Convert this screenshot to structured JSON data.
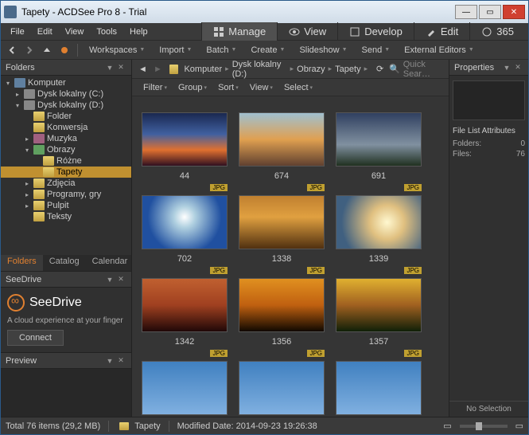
{
  "window": {
    "title": "Tapety - ACDSee Pro 8 - Trial"
  },
  "menu": [
    "File",
    "Edit",
    "View",
    "Tools",
    "Help"
  ],
  "modes": [
    {
      "label": "Manage",
      "active": true,
      "icon": "grid"
    },
    {
      "label": "View",
      "active": false,
      "icon": "eye"
    },
    {
      "label": "Develop",
      "active": false,
      "icon": "dev"
    },
    {
      "label": "Edit",
      "active": false,
      "icon": "wrench"
    },
    {
      "label": "365",
      "active": false,
      "icon": "365"
    }
  ],
  "toolbar_menus": [
    "Workspaces",
    "Import",
    "Batch",
    "Create",
    "Slideshow",
    "Send",
    "External Editors"
  ],
  "folders": {
    "title": "Folders",
    "tree": [
      {
        "label": "Komputer",
        "depth": 0,
        "exp": "▾",
        "icon": "comp"
      },
      {
        "label": "Dysk lokalny (C:)",
        "depth": 1,
        "exp": "▸",
        "icon": "drive"
      },
      {
        "label": "Dysk lokalny (D:)",
        "depth": 1,
        "exp": "▾",
        "icon": "drive"
      },
      {
        "label": "Folder",
        "depth": 2,
        "exp": "",
        "icon": "fold"
      },
      {
        "label": "Konwersja",
        "depth": 2,
        "exp": "",
        "icon": "fold"
      },
      {
        "label": "Muzyka",
        "depth": 2,
        "exp": "▸",
        "icon": "mus"
      },
      {
        "label": "Obrazy",
        "depth": 2,
        "exp": "▾",
        "icon": "img"
      },
      {
        "label": "Różne",
        "depth": 3,
        "exp": "",
        "icon": "fold"
      },
      {
        "label": "Tapety",
        "depth": 3,
        "exp": "",
        "icon": "fold",
        "sel": true
      },
      {
        "label": "Zdjęcia",
        "depth": 2,
        "exp": "▸",
        "icon": "fold"
      },
      {
        "label": "Programy, gry",
        "depth": 2,
        "exp": "▸",
        "icon": "fold"
      },
      {
        "label": "Pulpit",
        "depth": 2,
        "exp": "▸",
        "icon": "fold"
      },
      {
        "label": "Teksty",
        "depth": 2,
        "exp": "",
        "icon": "fold"
      }
    ]
  },
  "left_tabs": [
    {
      "label": "Folders",
      "active": true
    },
    {
      "label": "Catalog",
      "active": false
    },
    {
      "label": "Calendar",
      "active": false
    }
  ],
  "seedrive": {
    "title": "SeeDrive",
    "brand": "SeeDrive",
    "tag": "A cloud experience at your finger",
    "button": "Connect"
  },
  "preview": {
    "title": "Preview"
  },
  "breadcrumb": [
    "Komputer",
    "Dysk lokalny (D:)",
    "Obrazy",
    "Tapety"
  ],
  "quick_search": "Quick Sear…",
  "filterbar": [
    "Filter",
    "Group",
    "Sort",
    "View",
    "Select"
  ],
  "thumbs": [
    {
      "name": "44",
      "badge": "",
      "sky": "sky1"
    },
    {
      "name": "674",
      "badge": "",
      "sky": "sky2"
    },
    {
      "name": "691",
      "badge": "",
      "sky": "sky3"
    },
    {
      "name": "702",
      "badge": "JPG",
      "sky": "sky4"
    },
    {
      "name": "1338",
      "badge": "JPG",
      "sky": "sky5"
    },
    {
      "name": "1339",
      "badge": "JPG",
      "sky": "sky6"
    },
    {
      "name": "1342",
      "badge": "JPG",
      "sky": "sky7"
    },
    {
      "name": "1356",
      "badge": "JPG",
      "sky": "sky8"
    },
    {
      "name": "1357",
      "badge": "JPG",
      "sky": "sky9"
    },
    {
      "name": "",
      "badge": "JPG",
      "sky": "sky10"
    },
    {
      "name": "",
      "badge": "JPG",
      "sky": "sky10"
    },
    {
      "name": "",
      "badge": "JPG",
      "sky": "sky10"
    }
  ],
  "properties": {
    "title": "Properties",
    "section": "File List Attributes",
    "rows": [
      {
        "k": "Folders:",
        "v": "0"
      },
      {
        "k": "Files:",
        "v": "76"
      }
    ],
    "nosel": "No Selection"
  },
  "status": {
    "total": "Total 76 items (29,2 MB)",
    "folder": "Tapety",
    "modified": "Modified Date: 2014-09-23 19:26:38"
  }
}
